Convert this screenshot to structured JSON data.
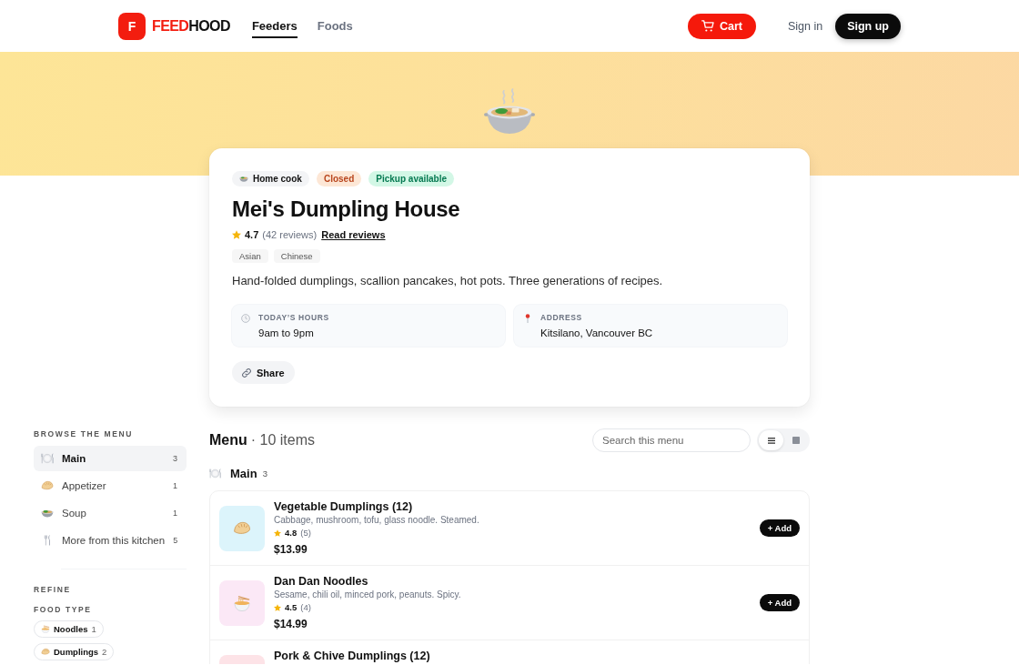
{
  "header": {
    "brand": {
      "mark": "F",
      "name": [
        "FEED",
        "HOOD"
      ]
    },
    "nav": [
      {
        "label": "Feeders",
        "selected": true
      },
      {
        "label": "Foods",
        "selected": false
      }
    ],
    "cart": "Cart",
    "sign_in": "Sign in",
    "sign_up": "Sign up"
  },
  "kitchen": {
    "badges": [
      {
        "kind": "neutral",
        "label": "Home cook"
      },
      {
        "kind": "warning",
        "label": "Closed"
      },
      {
        "kind": "success",
        "label": "Pickup available"
      }
    ],
    "name": "Mei's Dumpling House",
    "rating": {
      "score": "4.7",
      "reviews": "(42 reviews)",
      "link": "Read reviews"
    },
    "tags": [
      "Asian",
      "Chinese"
    ],
    "description": "Hand-folded dumplings, scallion pancakes, hot pots. Three generations of recipes.",
    "info": [
      {
        "kind": "hours",
        "label": "TODAY’S HOURS",
        "value": "9am to 9pm"
      },
      {
        "kind": "address",
        "label": "ADDRESS",
        "value": "Kitsilano, Vancouver BC"
      }
    ],
    "share": "Share"
  },
  "sidebar": {
    "title": "BROWSE THE MENU",
    "categories": [
      {
        "kind": "main",
        "label": "Main",
        "count": "3",
        "selected": true
      },
      {
        "kind": "appetizer",
        "label": "Appetizer",
        "count": "1",
        "selected": false
      },
      {
        "kind": "soup",
        "label": "Soup",
        "count": "1",
        "selected": false
      },
      {
        "kind": "more",
        "label": "More from this kitchen",
        "count": "5",
        "selected": false
      }
    ],
    "refine": "REFINE",
    "food_type": {
      "title": "FOOD TYPE",
      "options": [
        {
          "kind": "noodles",
          "label": "Noodles",
          "count": "1",
          "selected": false
        },
        {
          "kind": "dumplings",
          "label": "Dumplings",
          "count": "2",
          "selected": false
        }
      ]
    }
  },
  "menu": {
    "title": "Menu",
    "count": "· 10 items",
    "search": {
      "placeholder": "Search this menu"
    },
    "views": [
      {
        "kind": "list",
        "selected": true
      },
      {
        "kind": "grid",
        "selected": false
      }
    ],
    "sections": [
      {
        "kind": "main",
        "title": "Main",
        "count": "3",
        "items": [
          {
            "kind": "dumplings",
            "name": "Vegetable Dumplings (12)",
            "description": "Cabbage, mushroom, tofu, glass noodle. Steamed.",
            "rating": "4.8",
            "reviews": "(5)",
            "price": "$13.99",
            "color": "#dcf4fb",
            "add": "+ Add"
          },
          {
            "kind": "noodles",
            "name": "Dan Dan Noodles",
            "description": "Sesame, chili oil, minced pork, peanuts. Spicy.",
            "rating": "4.5",
            "reviews": "(4)",
            "price": "$14.99",
            "color": "#fbe8f6",
            "add": "+ Add"
          },
          {
            "name": "Pork & Chive Dumplings (12)",
            "color": "#fde3e7"
          }
        ]
      }
    ]
  }
}
